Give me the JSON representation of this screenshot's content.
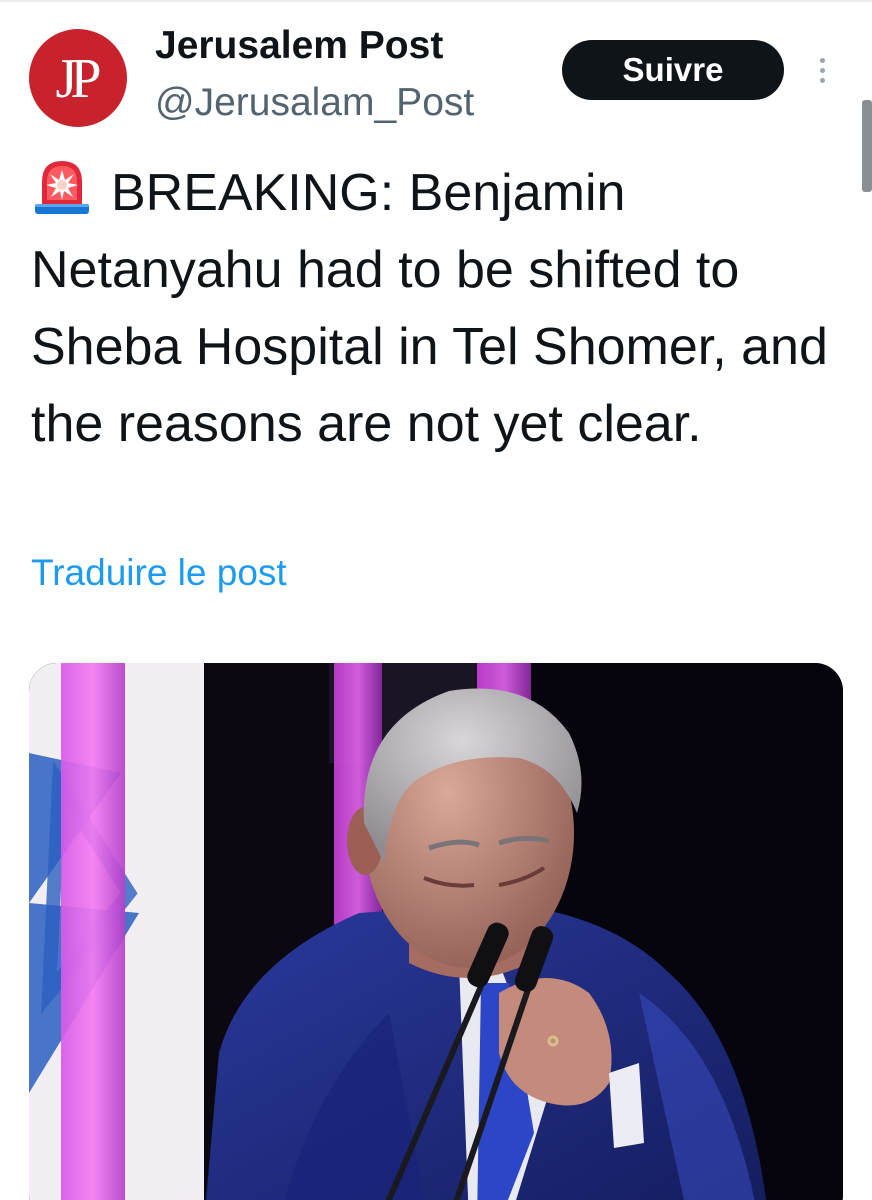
{
  "account": {
    "avatar_text": "JP",
    "display_name": "Jerusalem Post",
    "handle": "@Jerusalam_Post"
  },
  "header": {
    "follow_label": "Suivre"
  },
  "post": {
    "emoji": "🚨",
    "text": "BREAKING: Benjamin Netanyahu had to be shifted to Sheba Hospital in Tel Shomer, and the reasons are not yet clear.",
    "translate_label": "Traduire le post"
  },
  "colors": {
    "brand_red": "#c8232c",
    "link_blue": "#1d9bf0",
    "button_dark": "#0f1419",
    "muted_text": "#536471"
  },
  "icons": {
    "more": "more-vertical-icon",
    "emoji": "police-siren-icon"
  }
}
